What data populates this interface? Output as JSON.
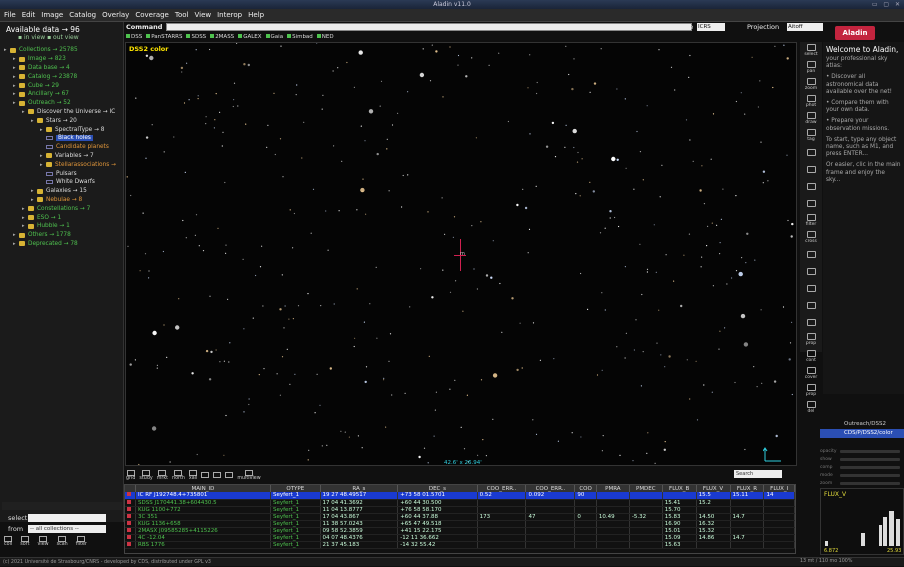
{
  "titlebar": {
    "title": "Aladin v11.0"
  },
  "menu": [
    "File",
    "Edit",
    "Image",
    "Catalog",
    "Overlay",
    "Coverage",
    "Tool",
    "View",
    "Interop",
    "Help"
  ],
  "left": {
    "available": "Available data → 96",
    "views": "▪ in view  ▪ out view",
    "tree": [
      {
        "label": "Collections → 25785",
        "cls": "g",
        "indent": 0,
        "type": "folder"
      },
      {
        "label": "Image → 823",
        "cls": "g",
        "indent": 1,
        "type": "folder"
      },
      {
        "label": "Data base → 4",
        "cls": "g",
        "indent": 1,
        "type": "folder"
      },
      {
        "label": "Catalog → 23878",
        "cls": "g",
        "indent": 1,
        "type": "folder"
      },
      {
        "label": "Cube → 29",
        "cls": "g",
        "indent": 1,
        "type": "folder"
      },
      {
        "label": "Ancillary → 67",
        "cls": "g",
        "indent": 1,
        "type": "folder"
      },
      {
        "label": "Outreach → 52",
        "cls": "g",
        "indent": 1,
        "type": "folder"
      },
      {
        "label": "Discover the Universe → IC",
        "cls": "w",
        "indent": 2,
        "type": "folder"
      },
      {
        "label": "Stars → 20",
        "cls": "w",
        "indent": 3,
        "type": "folder"
      },
      {
        "label": "SpectralType → 8",
        "cls": "w",
        "indent": 4,
        "type": "folder"
      },
      {
        "label": "Black holes",
        "cls": "sel",
        "indent": 4,
        "type": "leaf"
      },
      {
        "label": "Candidate planets",
        "cls": "o",
        "indent": 4,
        "type": "leaf"
      },
      {
        "label": "Variables → 7",
        "cls": "w",
        "indent": 4,
        "type": "folder"
      },
      {
        "label": "Stellarassociations →",
        "cls": "o",
        "indent": 4,
        "type": "folder"
      },
      {
        "label": "Pulsars",
        "cls": "w",
        "indent": 4,
        "type": "leaf"
      },
      {
        "label": "White Dwarfs",
        "cls": "w",
        "indent": 4,
        "type": "leaf"
      },
      {
        "label": "Galaxies → 15",
        "cls": "w",
        "indent": 3,
        "type": "folder"
      },
      {
        "label": "Nebulae → 8",
        "cls": "o",
        "indent": 3,
        "type": "folder"
      },
      {
        "label": "Constellations → 7",
        "cls": "g",
        "indent": 2,
        "type": "folder"
      },
      {
        "label": "ESO → 1",
        "cls": "g",
        "indent": 2,
        "type": "folder"
      },
      {
        "label": "Hubble → 1",
        "cls": "g",
        "indent": 2,
        "type": "folder"
      },
      {
        "label": "Others → 1778",
        "cls": "g",
        "indent": 1,
        "type": "folder"
      },
      {
        "label": "Deprecated → 78",
        "cls": "g",
        "indent": 1,
        "type": "folder"
      }
    ],
    "select_label": "select",
    "from_label": "from",
    "from_value": "-- all collections --",
    "icons": [
      "coll",
      "sort",
      "view",
      "scan",
      "filter"
    ]
  },
  "command": {
    "label": "Command",
    "frame_label": "Frame",
    "frame_value": "ICRS",
    "proj_label": "Projection",
    "proj_value": "Aitoff"
  },
  "surveys": [
    "DSS",
    "PanSTARRS",
    "SDSS",
    "2MASS",
    "GALEX",
    "Gaia",
    "Simbad",
    "NED"
  ],
  "sky": {
    "image_label": "DSS2 color",
    "fov": "42.6' x 26.94'",
    "reticle_label": "m"
  },
  "tools": [
    "select",
    "pan",
    "zoom",
    "phot",
    "draw",
    "tag",
    "",
    "",
    "",
    "",
    "filter",
    "cross",
    "",
    "",
    "",
    "",
    "",
    "prop",
    "cont",
    "cover",
    "prop",
    "del"
  ],
  "welcome": {
    "title": "Welcome to Aladin,",
    "subtitle": "your professional sky atlas:",
    "p1": "• Discover all astronomical data available over the net!",
    "p2": "• Compare them with your own data.",
    "p3": "• Prepare your observation missions.",
    "p4": "To start, type any object name, such as M1, and press ENTER...",
    "p5": "Or easier, clic in the main frame and enjoy the sky..."
  },
  "logo": "Aladin",
  "stack": [
    {
      "label": "Outreach/DSS2",
      "active": false
    },
    {
      "label": "CDS/P/DSS2/color",
      "active": true
    }
  ],
  "sliders": [
    "opacity",
    "show",
    "comp",
    "mode",
    "zoom"
  ],
  "histo": {
    "label": "FLUX_V",
    "min": "6.872",
    "max": "25.93"
  },
  "bottomtools": [
    "grid",
    "study",
    "mrkt",
    "north",
    "xall",
    "",
    "",
    "",
    "multiview"
  ],
  "search_placeholder": "Search",
  "table": {
    "headers": [
      "MAIN_ID",
      "OTYPE",
      "RA_s",
      "DEC_s",
      "COO_ERR..",
      "COO_ERR..",
      "COO",
      "PMRA",
      "PMDEC",
      "FLUX_B",
      "FLUX_V",
      "FLUX_R",
      "FLUX_I"
    ],
    "rows": [
      {
        "hl": true,
        "cells": [
          "IC RF J192748.4+735801",
          "Seyfert_1",
          "19 27 48.49517",
          "+73 58 01.5701",
          "0.52",
          "0.092",
          "90",
          "",
          "",
          "",
          "15.5",
          "15.11",
          "14"
        ]
      },
      {
        "hl": false,
        "cells": [
          "SDSS J170441.38+604430.5",
          "Seyfert_1",
          "17 04 41.3692",
          "+60 44 30.500",
          "",
          "",
          "",
          "",
          "",
          "15.41",
          "15.2",
          "",
          ""
        ]
      },
      {
        "hl": false,
        "cells": [
          "KUG 1100+772",
          "Seyfert_1",
          "11 04 13.8777",
          "+76 58 58.170",
          "",
          "",
          "",
          "",
          "",
          "15.70",
          "",
          "",
          ""
        ]
      },
      {
        "hl": false,
        "cells": [
          "3C 351",
          "Seyfert_1",
          "17 04 43.867",
          "+60 44 37.88",
          "173",
          "47",
          "0",
          "10.49",
          "-5.32",
          "15.83",
          "14.50",
          "14.7",
          ""
        ]
      },
      {
        "hl": false,
        "cells": [
          "KUG 1136+658",
          "Seyfert_1",
          "11 38 57.0243",
          "+65 47 49.518",
          "",
          "",
          "",
          "",
          "",
          "16.90",
          "16.32",
          "",
          ""
        ]
      },
      {
        "hl": false,
        "cells": [
          "2MASX J09585285+4115226",
          "Seyfert_1",
          "09 58 52.3859",
          "+41 15 22.175",
          "",
          "",
          "",
          "",
          "",
          "15.01",
          "15.32",
          "",
          ""
        ]
      },
      {
        "hl": false,
        "cells": [
          "4C -12.04",
          "Seyfert_1",
          "04 07 48.4376",
          "-12 11 36.662",
          "",
          "",
          "",
          "",
          "",
          "15.09",
          "14.86",
          "14.7",
          ""
        ]
      },
      {
        "hl": false,
        "cells": [
          "RBS 1776",
          "Seyfert_1",
          "21 37 45.183",
          "-14 32 55.42",
          "",
          "",
          "",
          "",
          "",
          "15.63",
          "",
          "",
          ""
        ]
      }
    ]
  },
  "status": "(c) 2021 Université de Strasbourg/CNRS - developed by CDS, distributed under GPL v3",
  "coord_status": "13 mt / 110 mo  100%"
}
